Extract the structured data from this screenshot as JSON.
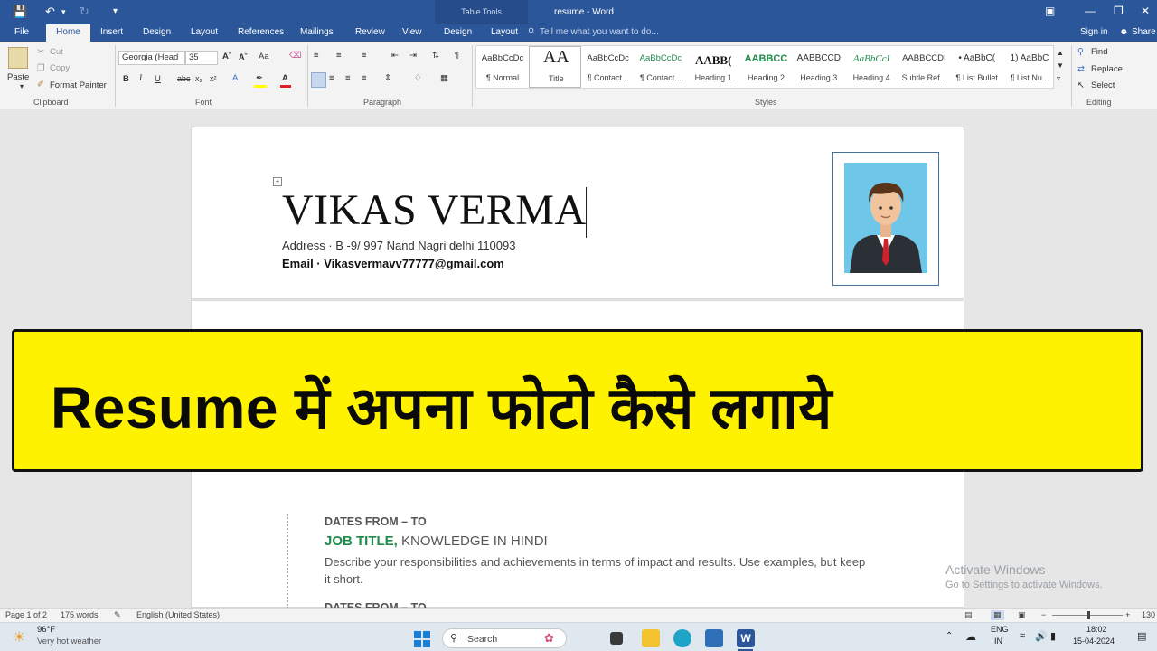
{
  "titlebar": {
    "table_tools": "Table Tools",
    "doc_title": "resume - Word"
  },
  "tabs": {
    "file": "File",
    "home": "Home",
    "insert": "Insert",
    "design": "Design",
    "layout": "Layout",
    "references": "References",
    "mailings": "Mailings",
    "review": "Review",
    "view": "View",
    "tt_design": "Design",
    "tt_layout": "Layout",
    "tell_me": "Tell me what you want to do...",
    "sign_in": "Sign in",
    "share": "Share"
  },
  "ribbon": {
    "clipboard": {
      "paste": "Paste",
      "cut": "Cut",
      "copy": "Copy",
      "format_painter": "Format Painter",
      "label": "Clipboard"
    },
    "font": {
      "family": "Georgia (Head",
      "size": "35",
      "label": "Font",
      "case_btn": "Aa"
    },
    "paragraph": {
      "label": "Paragraph"
    },
    "styles": {
      "label": "Styles",
      "items": [
        {
          "preview": "AaBbCcDc",
          "name": "¶ Normal"
        },
        {
          "preview": "AA",
          "name": "Title"
        },
        {
          "preview": "AaBbCcDc",
          "name": "¶ Contact..."
        },
        {
          "preview": "AaBbCcDc",
          "name": "¶ Contact..."
        },
        {
          "preview": "AABB(",
          "name": "Heading 1"
        },
        {
          "preview": "AABBCC",
          "name": "Heading 2"
        },
        {
          "preview": "AABBCCD",
          "name": "Heading 3"
        },
        {
          "preview": "AaBbCcI",
          "name": "Heading 4"
        },
        {
          "preview": "AABBCCDI",
          "name": "Subtle Ref..."
        },
        {
          "preview": "• AaBbC(",
          "name": "¶ List Bullet"
        },
        {
          "preview": "1) AaBbC",
          "name": "¶ List Nu..."
        }
      ]
    },
    "editing": {
      "find": "Find",
      "replace": "Replace",
      "select": "Select",
      "label": "Editing"
    }
  },
  "document": {
    "name": "VIKAS VERMA",
    "address": "Address · B -9/ 997 Nand Nagri delhi 110093",
    "email": "Email · Vikasvermavv77777@gmail.com",
    "dates_1": "DATES FROM – TO",
    "job_title": "JOB TITLE,",
    "job_rest": " KNOWLEDGE IN HINDI",
    "description": "Describe your responsibilities and achievements in terms of impact and results. Use examples, but keep it short.",
    "dates_2": "DATES FROM – TO"
  },
  "banner": {
    "text": "Resume में अपना फोटो कैसे लगाये"
  },
  "activate": {
    "line1": "Activate Windows",
    "line2": "Go to Settings to activate Windows."
  },
  "statusbar": {
    "page": "Page 1 of 2",
    "words": "175 words",
    "language": "English (United States)",
    "zoom": "130"
  },
  "taskbar": {
    "temperature": "96°F",
    "weather": "Very hot weather",
    "search": "Search",
    "lang1": "ENG",
    "lang2": "IN",
    "time": "18:02",
    "date": "15-04-2024"
  },
  "colors": {
    "word_blue": "#2b579a",
    "banner_yellow": "#fff200",
    "job_green": "#1f8a4c"
  }
}
